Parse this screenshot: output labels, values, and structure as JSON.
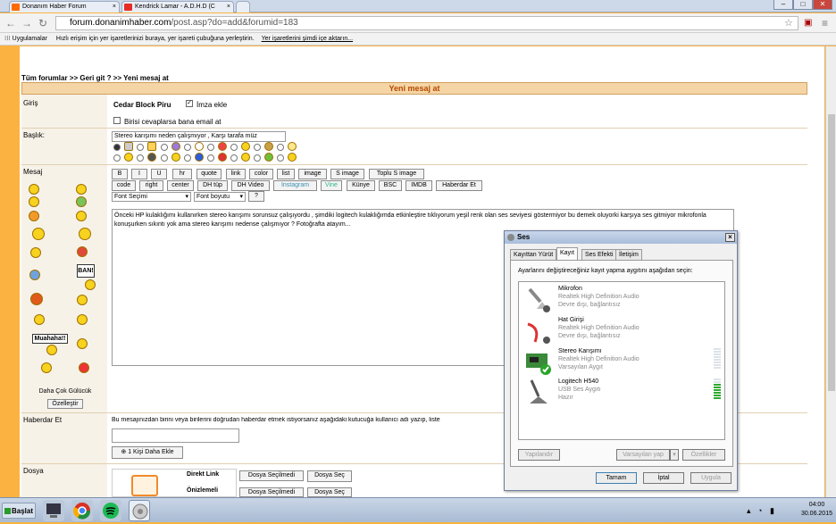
{
  "browser": {
    "tabs": [
      {
        "label": "Donanım Haber Forum",
        "icon": "dh-favicon",
        "color": "#ff6b00"
      },
      {
        "label": "Kendrick Lamar - A.D.H.D (C",
        "icon": "youtube-favicon",
        "color": "#e52d27"
      }
    ],
    "url_host": "forum.donanimhaber.com",
    "url_path": "/post.asp?do=add&forumid=183",
    "bookmarks_label": "Uygulamalar",
    "bookmarks_hint": "Hızlı erişim için yer işaretlerinizi buraya, yer işareti çubuğuna yerleştirin.",
    "bookmarks_link": "Yer işaretlerini şimdi içe aktarın..."
  },
  "forum": {
    "breadcrumb": "Tüm forumlar >> Geri git ? >> Yeni mesaj at",
    "header": "Yeni mesaj at",
    "giris_label": "Giriş",
    "username": "Cedar Block Piru",
    "signature_label": "İmza ekle",
    "email_label": "Birisi cevaplarsa bana email at",
    "title_label": "Başlık:",
    "title_value": "Stereo karışımı neden çalışmıyor , Karşı tarafa müz",
    "message_label": "Mesaj",
    "more_smileys": "Daha Çok Gülücük",
    "customize": "Özelleştir",
    "smiley_banner": "Muahaha!!",
    "smiley_sign": "BAN!",
    "toolbar_row1": [
      "B",
      "I",
      "U",
      "hr",
      "quote",
      "link",
      "color",
      "list",
      "image",
      "S image",
      "Toplu S image"
    ],
    "toolbar_row2": [
      "code",
      "right",
      "center",
      "DH tüp",
      "DH Video",
      "Instagram",
      "Vine",
      "Künye",
      "BSC",
      "IMDB",
      "Haberdar Et"
    ],
    "font_select": "Font Seçimi",
    "size_select": "Font boyutu",
    "help_button": "?",
    "message_text": "Önceki HP kulaklığımı kullanırken stereo karışımı sorunsuz çalışıyordu , şimdiki logitech kulaklığımda etkinleştire tıklıyorum yeşil renk olan ses seviyesi göstermiyor bu demek oluyorki karşıya ses gitmiyor mikrofonla konuşurken sıkıntı yok ama stereo karışımı nedense çalışmıyor ? Fotoğrafta atayım...",
    "notify_label": "Haberdar Et",
    "notify_text": "Bu mesajınızdan birini veya birilerini doğrudan haberdar etmek istiyorsanız aşağıdaki kutucuğa kullanıcı adı yazıp, liste",
    "add_person": "1 Kişi Daha Ekle",
    "file_label": "Dosya",
    "direct_link": "Direkt Link",
    "preview": "Önizlemeli",
    "no_file": "Dosya Seçilmedi",
    "choose_file": "Dosya Seç"
  },
  "dialog": {
    "title": "Ses",
    "tabs": [
      "Kayıttan Yürüt",
      "Kayıt",
      "Ses Efekti",
      "İletişim"
    ],
    "instruction": "Ayarlarını değiştireceğiniz kayıt yapma aygıtını aşağıdan seçin:",
    "devices": [
      {
        "name": "Mikrofon",
        "driver": "Realtek High Definition Audio",
        "status": "Devre dışı, bağlantısız",
        "icon": "microphone-icon"
      },
      {
        "name": "Hat Girişi",
        "driver": "Realtek High Definition Audio",
        "status": "Devre dışı, bağlantısız",
        "icon": "line-in-icon"
      },
      {
        "name": "Stereo Karışımı",
        "driver": "Realtek High Definition Audio",
        "status": "Varsayılan Aygıt",
        "icon": "sound-card-icon",
        "level": 0
      },
      {
        "name": "Logitech H540",
        "driver": "USB Ses Aygıtı",
        "status": "Hazır",
        "icon": "headset-mic-icon",
        "level": 0.8
      }
    ],
    "configure": "Yapılandır",
    "set_default": "Varsayılan yap",
    "properties": "Özellikler",
    "ok": "Tamam",
    "cancel": "İptal",
    "apply": "Uygula"
  },
  "taskbar": {
    "start": "Başlat",
    "time": "04:00",
    "date": "30.06.2015"
  }
}
